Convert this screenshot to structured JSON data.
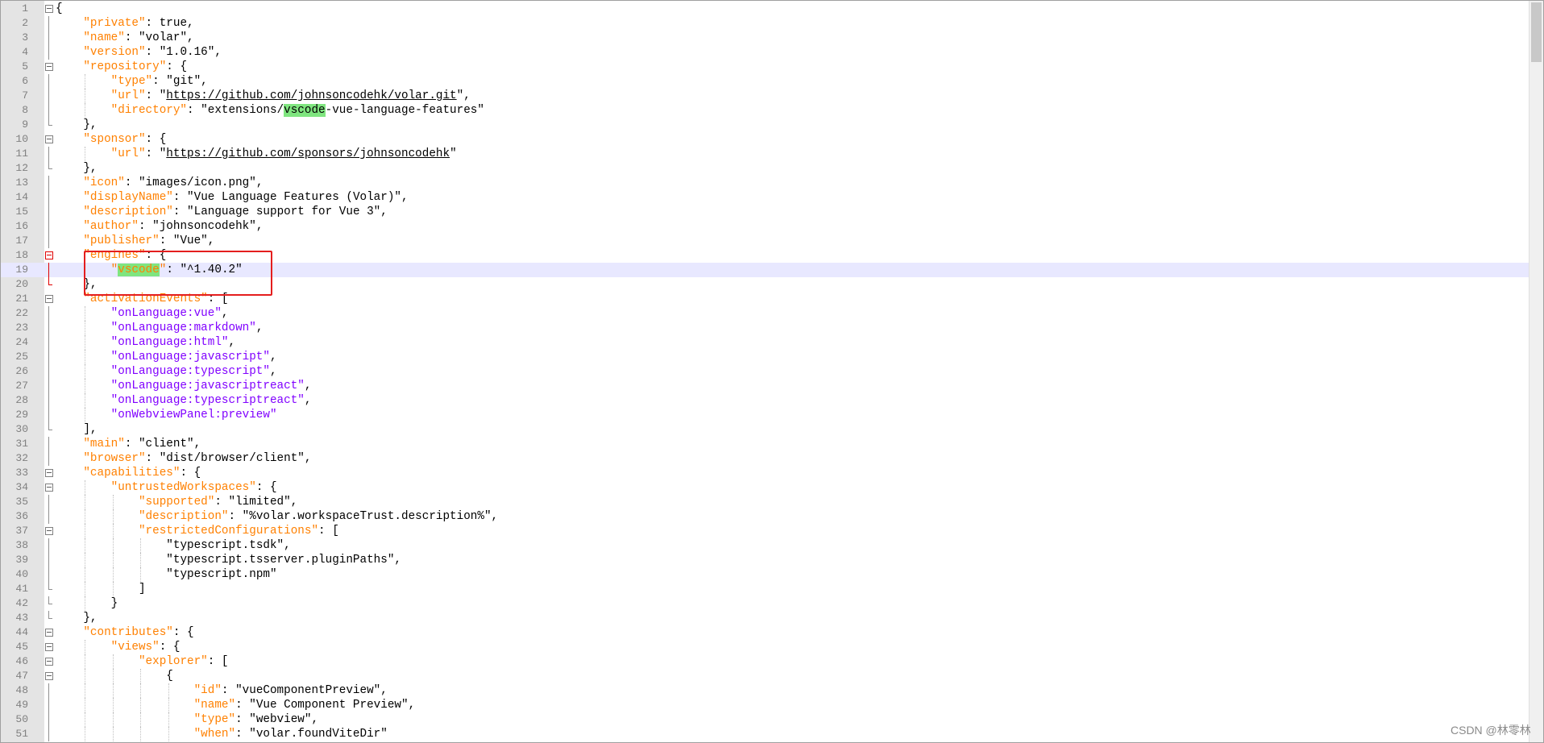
{
  "editor": {
    "current_line": 19,
    "lines": [
      {
        "n": "1",
        "fold": "open",
        "indent": 0,
        "segs": [
          [
            "t",
            "{"
          ]
        ]
      },
      {
        "n": "2",
        "fold": "line",
        "indent": 1,
        "segs": [
          [
            "k",
            "\"private\""
          ],
          [
            "t",
            ": true,"
          ]
        ]
      },
      {
        "n": "3",
        "fold": "line",
        "indent": 1,
        "segs": [
          [
            "k",
            "\"name\""
          ],
          [
            "t",
            ": \"volar\","
          ]
        ]
      },
      {
        "n": "4",
        "fold": "line",
        "indent": 1,
        "segs": [
          [
            "k",
            "\"version\""
          ],
          [
            "t",
            ": \"1.0.16\","
          ]
        ]
      },
      {
        "n": "5",
        "fold": "open",
        "indent": 1,
        "segs": [
          [
            "k",
            "\"repository\""
          ],
          [
            "t",
            ": {"
          ]
        ]
      },
      {
        "n": "6",
        "fold": "line",
        "indent": 2,
        "segs": [
          [
            "k",
            "\"type\""
          ],
          [
            "t",
            ": \"git\","
          ]
        ]
      },
      {
        "n": "7",
        "fold": "line",
        "indent": 2,
        "segs": [
          [
            "k",
            "\"url\""
          ],
          [
            "t",
            ": \""
          ],
          [
            "u",
            "https://github.com/johnsoncodehk/volar.git"
          ],
          [
            "t",
            "\","
          ]
        ]
      },
      {
        "n": "8",
        "fold": "line",
        "indent": 2,
        "segs": [
          [
            "k",
            "\"directory\""
          ],
          [
            "t",
            ": \"extensions/"
          ],
          [
            "h",
            "vscode"
          ],
          [
            "t",
            "-vue-language-features\""
          ]
        ]
      },
      {
        "n": "9",
        "fold": "end",
        "indent": 1,
        "segs": [
          [
            "t",
            "},"
          ]
        ]
      },
      {
        "n": "10",
        "fold": "open",
        "indent": 1,
        "segs": [
          [
            "k",
            "\"sponsor\""
          ],
          [
            "t",
            ": {"
          ]
        ]
      },
      {
        "n": "11",
        "fold": "line",
        "indent": 2,
        "segs": [
          [
            "k",
            "\"url\""
          ],
          [
            "t",
            ": \""
          ],
          [
            "u",
            "https://github.com/sponsors/johnsoncodehk"
          ],
          [
            "t",
            "\""
          ]
        ]
      },
      {
        "n": "12",
        "fold": "end",
        "indent": 1,
        "segs": [
          [
            "t",
            "},"
          ]
        ]
      },
      {
        "n": "13",
        "fold": "line",
        "indent": 1,
        "segs": [
          [
            "k",
            "\"icon\""
          ],
          [
            "t",
            ": \"images/icon.png\","
          ]
        ]
      },
      {
        "n": "14",
        "fold": "line",
        "indent": 1,
        "segs": [
          [
            "k",
            "\"displayName\""
          ],
          [
            "t",
            ": \"Vue Language Features (Volar)\","
          ]
        ]
      },
      {
        "n": "15",
        "fold": "line",
        "indent": 1,
        "segs": [
          [
            "k",
            "\"description\""
          ],
          [
            "t",
            ": \"Language support for Vue 3\","
          ]
        ]
      },
      {
        "n": "16",
        "fold": "line",
        "indent": 1,
        "segs": [
          [
            "k",
            "\"author\""
          ],
          [
            "t",
            ": \"johnsoncodehk\","
          ]
        ]
      },
      {
        "n": "17",
        "fold": "line",
        "indent": 1,
        "segs": [
          [
            "k",
            "\"publisher\""
          ],
          [
            "t",
            ": \"Vue\","
          ]
        ]
      },
      {
        "n": "18",
        "fold": "open-red",
        "indent": 1,
        "segs": [
          [
            "k",
            "\"engines\""
          ],
          [
            "t",
            ": {"
          ]
        ]
      },
      {
        "n": "19",
        "fold": "line-red",
        "indent": 2,
        "segs": [
          [
            "k",
            "\""
          ],
          [
            "kh",
            "vscode"
          ],
          [
            "k",
            "\""
          ],
          [
            "t",
            ": \"^1.40.2\""
          ]
        ]
      },
      {
        "n": "20",
        "fold": "end-red",
        "indent": 1,
        "segs": [
          [
            "t",
            "},"
          ]
        ]
      },
      {
        "n": "21",
        "fold": "open",
        "indent": 1,
        "segs": [
          [
            "k",
            "\"activationEvents\""
          ],
          [
            "t",
            ": ["
          ]
        ]
      },
      {
        "n": "22",
        "fold": "line",
        "indent": 2,
        "segs": [
          [
            "p",
            "\"onLanguage:vue\""
          ],
          [
            "t",
            ","
          ]
        ]
      },
      {
        "n": "23",
        "fold": "line",
        "indent": 2,
        "segs": [
          [
            "p",
            "\"onLanguage:markdown\""
          ],
          [
            "t",
            ","
          ]
        ]
      },
      {
        "n": "24",
        "fold": "line",
        "indent": 2,
        "segs": [
          [
            "p",
            "\"onLanguage:html\""
          ],
          [
            "t",
            ","
          ]
        ]
      },
      {
        "n": "25",
        "fold": "line",
        "indent": 2,
        "segs": [
          [
            "p",
            "\"onLanguage:javascript\""
          ],
          [
            "t",
            ","
          ]
        ]
      },
      {
        "n": "26",
        "fold": "line",
        "indent": 2,
        "segs": [
          [
            "p",
            "\"onLanguage:typescript\""
          ],
          [
            "t",
            ","
          ]
        ]
      },
      {
        "n": "27",
        "fold": "line",
        "indent": 2,
        "segs": [
          [
            "p",
            "\"onLanguage:javascriptreact\""
          ],
          [
            "t",
            ","
          ]
        ]
      },
      {
        "n": "28",
        "fold": "line",
        "indent": 2,
        "segs": [
          [
            "p",
            "\"onLanguage:typescriptreact\""
          ],
          [
            "t",
            ","
          ]
        ]
      },
      {
        "n": "29",
        "fold": "line",
        "indent": 2,
        "segs": [
          [
            "p",
            "\"onWebviewPanel:preview\""
          ]
        ]
      },
      {
        "n": "30",
        "fold": "end",
        "indent": 1,
        "segs": [
          [
            "t",
            "],"
          ]
        ]
      },
      {
        "n": "31",
        "fold": "line",
        "indent": 1,
        "segs": [
          [
            "k",
            "\"main\""
          ],
          [
            "t",
            ": \"client\","
          ]
        ]
      },
      {
        "n": "32",
        "fold": "line",
        "indent": 1,
        "segs": [
          [
            "k",
            "\"browser\""
          ],
          [
            "t",
            ": \"dist/browser/client\","
          ]
        ]
      },
      {
        "n": "33",
        "fold": "open",
        "indent": 1,
        "segs": [
          [
            "k",
            "\"capabilities\""
          ],
          [
            "t",
            ": {"
          ]
        ]
      },
      {
        "n": "34",
        "fold": "open",
        "indent": 2,
        "segs": [
          [
            "k",
            "\"untrustedWorkspaces\""
          ],
          [
            "t",
            ": {"
          ]
        ]
      },
      {
        "n": "35",
        "fold": "line",
        "indent": 3,
        "segs": [
          [
            "k",
            "\"supported\""
          ],
          [
            "t",
            ": \"limited\","
          ]
        ]
      },
      {
        "n": "36",
        "fold": "line",
        "indent": 3,
        "segs": [
          [
            "k",
            "\"description\""
          ],
          [
            "t",
            ": \"%volar.workspaceTrust.description%\","
          ]
        ]
      },
      {
        "n": "37",
        "fold": "open",
        "indent": 3,
        "segs": [
          [
            "k",
            "\"restrictedConfigurations\""
          ],
          [
            "t",
            ": ["
          ]
        ]
      },
      {
        "n": "38",
        "fold": "line",
        "indent": 4,
        "segs": [
          [
            "t",
            "\"typescript.tsdk\","
          ]
        ]
      },
      {
        "n": "39",
        "fold": "line",
        "indent": 4,
        "segs": [
          [
            "t",
            "\"typescript.tsserver.pluginPaths\","
          ]
        ]
      },
      {
        "n": "40",
        "fold": "line",
        "indent": 4,
        "segs": [
          [
            "t",
            "\"typescript.npm\""
          ]
        ]
      },
      {
        "n": "41",
        "fold": "end",
        "indent": 3,
        "segs": [
          [
            "t",
            "]"
          ]
        ]
      },
      {
        "n": "42",
        "fold": "end",
        "indent": 2,
        "segs": [
          [
            "t",
            "}"
          ]
        ]
      },
      {
        "n": "43",
        "fold": "end",
        "indent": 1,
        "segs": [
          [
            "t",
            "},"
          ]
        ]
      },
      {
        "n": "44",
        "fold": "open",
        "indent": 1,
        "segs": [
          [
            "k",
            "\"contributes\""
          ],
          [
            "t",
            ": {"
          ]
        ]
      },
      {
        "n": "45",
        "fold": "open",
        "indent": 2,
        "segs": [
          [
            "k",
            "\"views\""
          ],
          [
            "t",
            ": {"
          ]
        ]
      },
      {
        "n": "46",
        "fold": "open",
        "indent": 3,
        "segs": [
          [
            "k",
            "\"explorer\""
          ],
          [
            "t",
            ": ["
          ]
        ]
      },
      {
        "n": "47",
        "fold": "open",
        "indent": 4,
        "segs": [
          [
            "t",
            "{"
          ]
        ]
      },
      {
        "n": "48",
        "fold": "line",
        "indent": 5,
        "segs": [
          [
            "k",
            "\"id\""
          ],
          [
            "t",
            ": \"vueComponentPreview\","
          ]
        ]
      },
      {
        "n": "49",
        "fold": "line",
        "indent": 5,
        "segs": [
          [
            "k",
            "\"name\""
          ],
          [
            "t",
            ": \"Vue Component Preview\","
          ]
        ]
      },
      {
        "n": "50",
        "fold": "line",
        "indent": 5,
        "segs": [
          [
            "k",
            "\"type\""
          ],
          [
            "t",
            ": \"webview\","
          ]
        ]
      },
      {
        "n": "51",
        "fold": "line",
        "indent": 5,
        "segs": [
          [
            "k",
            "\"when\""
          ],
          [
            "t",
            ": \"volar.foundViteDir\""
          ]
        ]
      }
    ]
  },
  "watermark": "CSDN @林零林",
  "colors": {
    "key": "#ff8000",
    "event_string": "#8000ff",
    "match_highlight": "#7fe57f",
    "current_line": "#e8e8ff",
    "annotation_box": "#e41e1e"
  },
  "icons": [
    "fold-box-icon",
    "fold-line-icon"
  ]
}
